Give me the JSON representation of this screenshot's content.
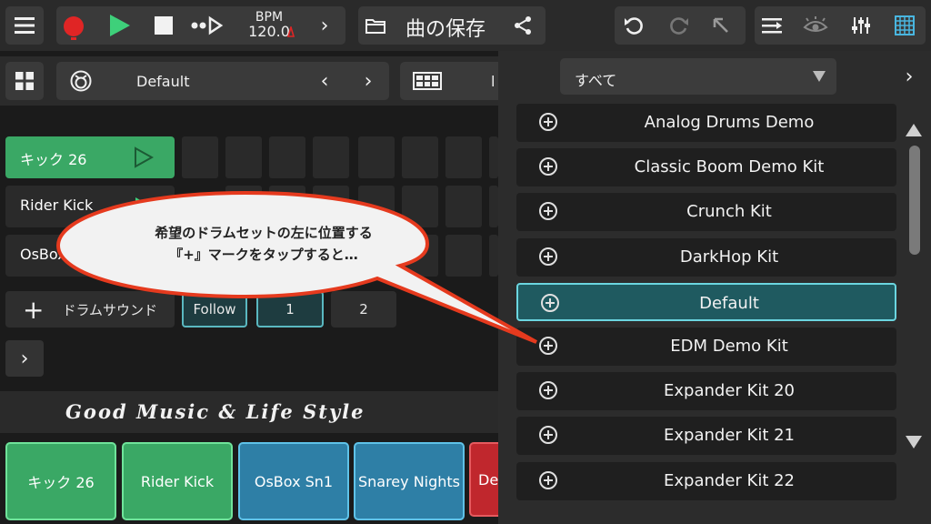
{
  "transport": {
    "bpm_label": "BPM",
    "bpm_value": "120.0",
    "song_title": "曲の保存"
  },
  "kit_bar": {
    "kit_name": "Default",
    "trailing_char": "l"
  },
  "tracks": [
    {
      "label": "キック 26"
    },
    {
      "label": "Rider Kick"
    },
    {
      "label": "OsBox"
    }
  ],
  "controls": {
    "add_label": "ドラムサウンド",
    "follow_label": "Follow",
    "page1": "1",
    "page2": "2"
  },
  "tagline": "Good Music & Life Style",
  "pads": [
    {
      "label": "キック 26"
    },
    {
      "label": "Rider Kick"
    },
    {
      "label": "OsBox Sn1"
    },
    {
      "label": "Snarey Nights"
    },
    {
      "label": "De"
    }
  ],
  "panel": {
    "filter": "すべて",
    "kits": [
      {
        "name": "Analog Drums Demo"
      },
      {
        "name": "Classic Boom Demo Kit"
      },
      {
        "name": "Crunch Kit"
      },
      {
        "name": "DarkHop Kit"
      },
      {
        "name": "Default",
        "selected": true
      },
      {
        "name": "EDM Demo Kit"
      },
      {
        "name": "Expander Kit 20"
      },
      {
        "name": "Expander Kit 21"
      },
      {
        "name": "Expander Kit 22"
      }
    ]
  },
  "callout": {
    "line1": "希望のドラムセットの左に位置する",
    "line2": "『+』マークをタップすると…"
  },
  "colors": {
    "accent_green": "#3aa865",
    "accent_blue": "#2e7fa6",
    "selection_teal": "#1f5a60"
  }
}
